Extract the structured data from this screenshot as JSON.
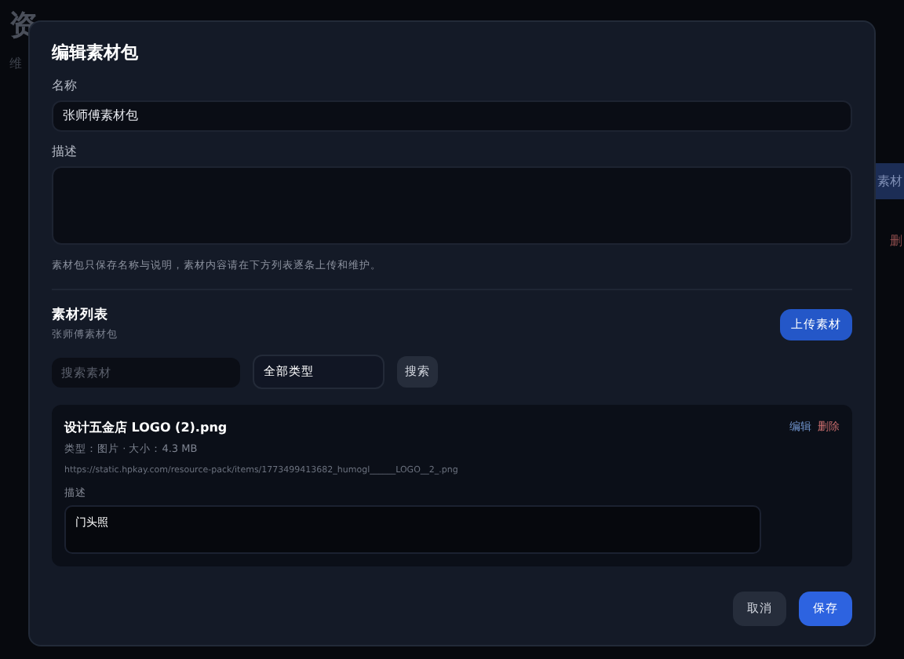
{
  "background": {
    "title": "资",
    "subtitle": "维",
    "button": "素材",
    "side_texts": [
      "删"
    ]
  },
  "dialog": {
    "title": "编辑素材包",
    "name_field": {
      "label": "名称",
      "value": "张师傅素材包"
    },
    "description_field": {
      "label": "描述"
    },
    "hint": "素材包只保存名称与说明，素材内容请在下方列表逐条上传和维护。",
    "materials": {
      "title": "素材列表",
      "subtitle": "张师傅素材包",
      "upload_button": "上传素材",
      "search": {
        "placeholder": "搜索素材"
      },
      "type_filter": "全部类型",
      "search_button": "搜索",
      "items": [
        {
          "name": "设计五金店 LOGO (2).png",
          "meta": "类型：图片 · 大小：4.3 MB",
          "url": "https://static.hpkay.com/resource-pack/items/1773499413682_humogl______LOGO__2_.png",
          "edit": "编辑",
          "delete": "删除",
          "description_label": "描述",
          "description": "门头照"
        }
      ]
    },
    "buttons": [
      "取消",
      "保存"
    ]
  }
}
